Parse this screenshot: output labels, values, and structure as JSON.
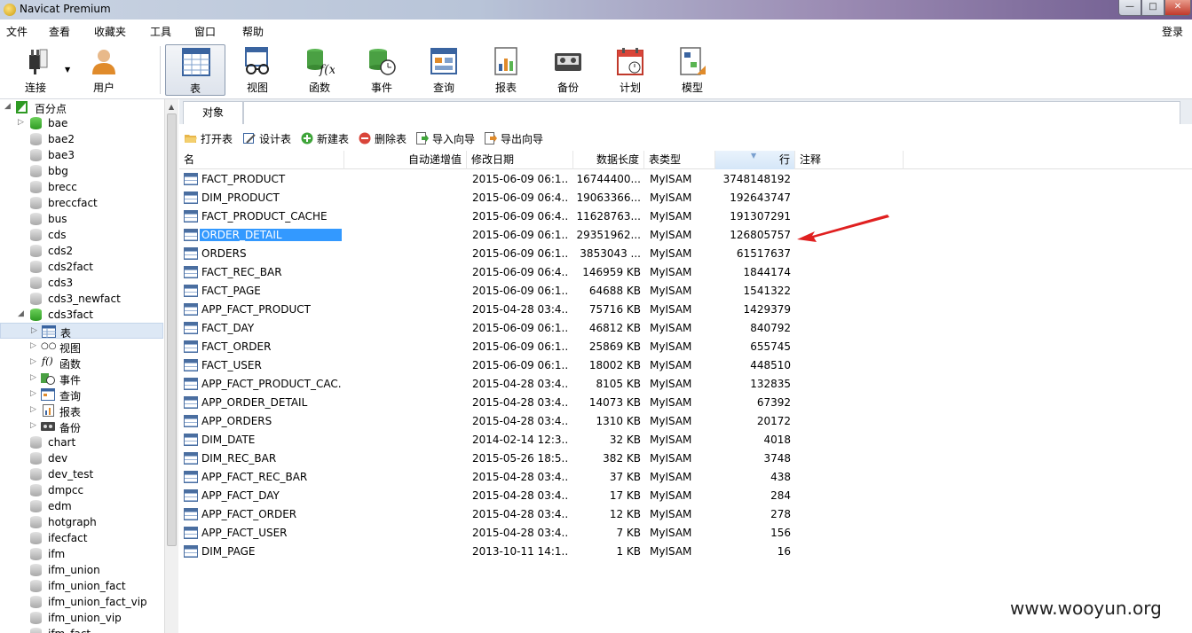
{
  "window": {
    "title": "Navicat Premium"
  },
  "menu": {
    "items": [
      "文件",
      "查看",
      "收藏夹",
      "工具",
      "窗口",
      "帮助"
    ],
    "login": "登录"
  },
  "toolbar": {
    "items": [
      {
        "label": "连接",
        "icon": "plug-icon"
      },
      {
        "label": "用户",
        "icon": "user-icon"
      },
      {
        "label": "表",
        "icon": "table-icon",
        "active": true
      },
      {
        "label": "视图",
        "icon": "glasses-icon"
      },
      {
        "label": "函数",
        "icon": "function-icon"
      },
      {
        "label": "事件",
        "icon": "event-clock-icon"
      },
      {
        "label": "查询",
        "icon": "query-icon"
      },
      {
        "label": "报表",
        "icon": "report-icon"
      },
      {
        "label": "备份",
        "icon": "backup-icon"
      },
      {
        "label": "计划",
        "icon": "calendar-icon"
      },
      {
        "label": "模型",
        "icon": "model-icon"
      }
    ]
  },
  "tree": {
    "root": "百分点",
    "databases_before": [
      "bae",
      "bae2",
      "bae3",
      "bbg",
      "brecc",
      "breccfact",
      "bus",
      "cds",
      "cds2",
      "cds2fact",
      "cds3",
      "cds3_newfact"
    ],
    "open_db": "cds3fact",
    "children": [
      "表",
      "视图",
      "函数",
      "事件",
      "查询",
      "报表",
      "备份"
    ],
    "databases_after": [
      "chart",
      "dev",
      "dev_test",
      "dmpcc",
      "edm",
      "hotgraph",
      "ifecfact",
      "ifm",
      "ifm_union",
      "ifm_union_fact",
      "ifm_union_fact_vip",
      "ifm_union_vip",
      "ifm_fact"
    ]
  },
  "tabs": {
    "objects": "对象"
  },
  "object_toolbar": {
    "open": "打开表",
    "design": "设计表",
    "new": "新建表",
    "delete": "删除表",
    "import": "导入向导",
    "export": "导出向导"
  },
  "grid": {
    "headers": {
      "name": "名",
      "auto_inc": "自动递增值",
      "modified": "修改日期",
      "data_length": "数据长度",
      "engine": "表类型",
      "rows": "行",
      "comment": "注释"
    },
    "rows": [
      {
        "name": "FACT_PRODUCT",
        "date": "2015-06-09 06:1...",
        "size": "16744400...",
        "type": "MyISAM",
        "rows": "3748148192"
      },
      {
        "name": "DIM_PRODUCT",
        "date": "2015-06-09 06:4...",
        "size": "19063366...",
        "type": "MyISAM",
        "rows": "192643747"
      },
      {
        "name": "FACT_PRODUCT_CACHE",
        "date": "2015-06-09 06:4...",
        "size": "11628763...",
        "type": "MyISAM",
        "rows": "191307291"
      },
      {
        "name": "ORDER_DETAIL",
        "date": "2015-06-09 06:1...",
        "size": "29351962...",
        "type": "MyISAM",
        "rows": "126805757",
        "selected": true
      },
      {
        "name": "ORDERS",
        "date": "2015-06-09 06:1...",
        "size": "3853043 ...",
        "type": "MyISAM",
        "rows": "61517637"
      },
      {
        "name": "FACT_REC_BAR",
        "date": "2015-06-09 06:4...",
        "size": "146959 KB",
        "type": "MyISAM",
        "rows": "1844174"
      },
      {
        "name": "FACT_PAGE",
        "date": "2015-06-09 06:1...",
        "size": "64688 KB",
        "type": "MyISAM",
        "rows": "1541322"
      },
      {
        "name": "APP_FACT_PRODUCT",
        "date": "2015-04-28 03:4...",
        "size": "75716 KB",
        "type": "MyISAM",
        "rows": "1429379"
      },
      {
        "name": "FACT_DAY",
        "date": "2015-06-09 06:1...",
        "size": "46812 KB",
        "type": "MyISAM",
        "rows": "840792"
      },
      {
        "name": "FACT_ORDER",
        "date": "2015-06-09 06:1...",
        "size": "25869 KB",
        "type": "MyISAM",
        "rows": "655745"
      },
      {
        "name": "FACT_USER",
        "date": "2015-06-09 06:1...",
        "size": "18002 KB",
        "type": "MyISAM",
        "rows": "448510"
      },
      {
        "name": "APP_FACT_PRODUCT_CAC...",
        "date": "2015-04-28 03:4...",
        "size": "8105 KB",
        "type": "MyISAM",
        "rows": "132835"
      },
      {
        "name": "APP_ORDER_DETAIL",
        "date": "2015-04-28 03:4...",
        "size": "14073 KB",
        "type": "MyISAM",
        "rows": "67392"
      },
      {
        "name": "APP_ORDERS",
        "date": "2015-04-28 03:4...",
        "size": "1310 KB",
        "type": "MyISAM",
        "rows": "20172"
      },
      {
        "name": "DIM_DATE",
        "date": "2014-02-14 12:3...",
        "size": "32 KB",
        "type": "MyISAM",
        "rows": "4018"
      },
      {
        "name": "DIM_REC_BAR",
        "date": "2015-05-26 18:5...",
        "size": "382 KB",
        "type": "MyISAM",
        "rows": "3748"
      },
      {
        "name": "APP_FACT_REC_BAR",
        "date": "2015-04-28 03:4...",
        "size": "37 KB",
        "type": "MyISAM",
        "rows": "438"
      },
      {
        "name": "APP_FACT_DAY",
        "date": "2015-04-28 03:4...",
        "size": "17 KB",
        "type": "MyISAM",
        "rows": "284"
      },
      {
        "name": "APP_FACT_ORDER",
        "date": "2015-04-28 03:4...",
        "size": "12 KB",
        "type": "MyISAM",
        "rows": "278"
      },
      {
        "name": "APP_FACT_USER",
        "date": "2015-04-28 03:4...",
        "size": "7 KB",
        "type": "MyISAM",
        "rows": "156"
      },
      {
        "name": "DIM_PAGE",
        "date": "2013-10-11 14:1...",
        "size": "1 KB",
        "type": "MyISAM",
        "rows": "16"
      }
    ]
  },
  "watermark": "www.wooyun.org",
  "colors": {
    "selection": "#3399ff",
    "arrow": "#e02020",
    "db_open": "#2e9a23"
  }
}
